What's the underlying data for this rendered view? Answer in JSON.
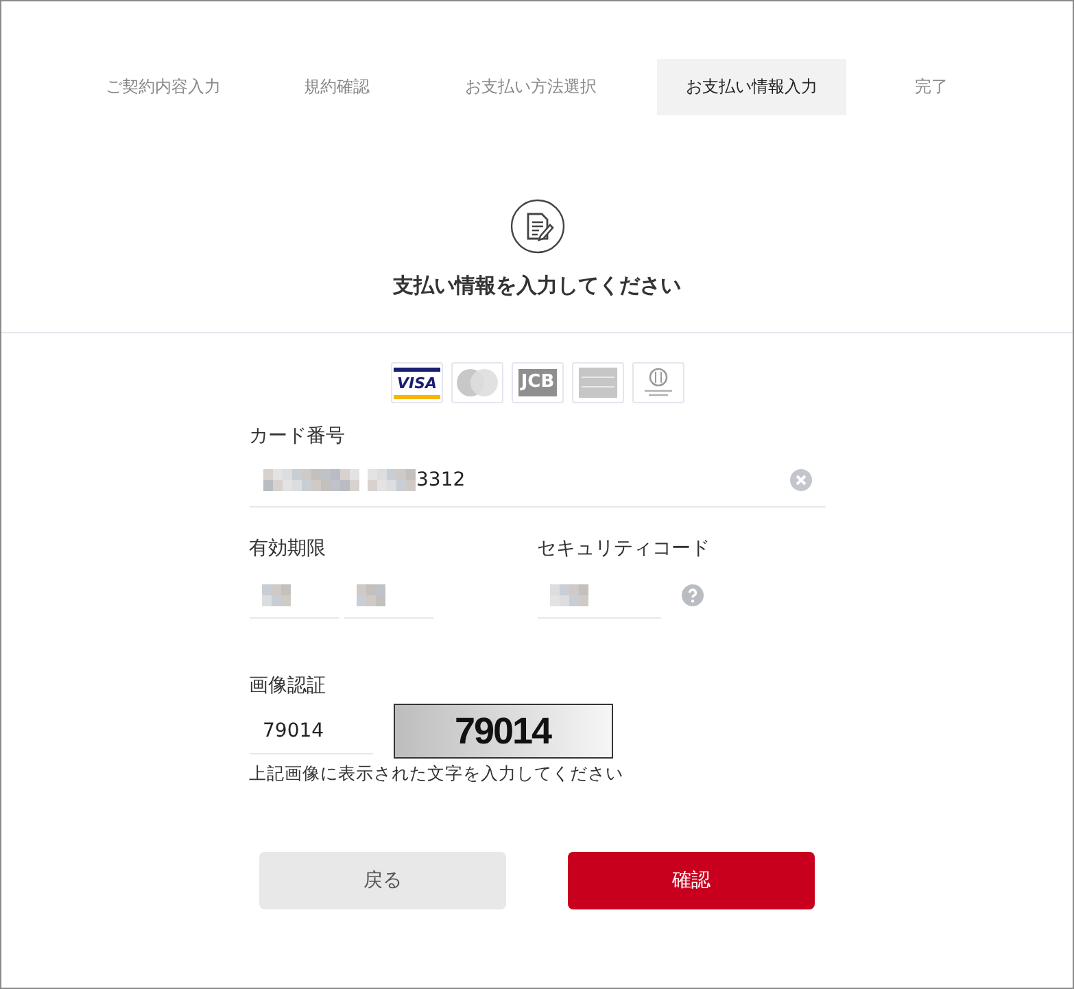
{
  "steps": [
    {
      "label": "ご契約内容入力",
      "selected": false
    },
    {
      "label": "規約確認",
      "selected": false
    },
    {
      "label": "お支払い方法選択",
      "selected": false
    },
    {
      "label": "お支払い情報入力",
      "selected": true
    },
    {
      "label": "完了",
      "selected": false
    }
  ],
  "heading": "支払い情報を入力してください",
  "card_brands": [
    {
      "kind": "visa",
      "label": "VISA",
      "selected": true
    },
    {
      "kind": "mastercard",
      "selected": false
    },
    {
      "kind": "jcb",
      "label": "JCB",
      "selected": false
    },
    {
      "kind": "amex",
      "selected": false
    },
    {
      "kind": "diners",
      "selected": false
    }
  ],
  "card_number": {
    "label": "カード番号",
    "value": "3312"
  },
  "expiry": {
    "label": "有効期限"
  },
  "security_code": {
    "label": "セキュリティコード"
  },
  "captcha": {
    "label": "画像認証",
    "value": "79014",
    "image_text": "79014",
    "hint": "上記画像に表示された文字を入力してください"
  },
  "buttons": [
    {
      "kind": "back",
      "label": "戻る"
    },
    {
      "kind": "confirm",
      "label": "確認"
    }
  ]
}
